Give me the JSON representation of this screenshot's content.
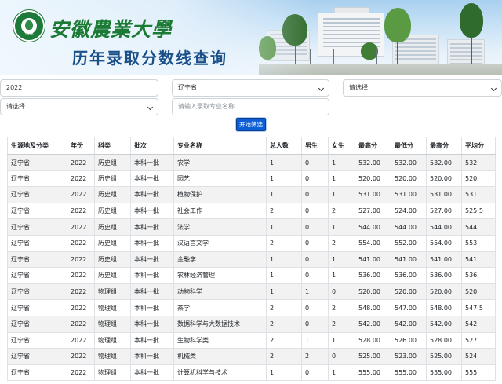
{
  "header": {
    "university_name": "安徽農業大學",
    "page_title": "历年录取分数线查询",
    "seal_year": "1928"
  },
  "filters": {
    "year": {
      "value": "2022"
    },
    "province": {
      "value": "辽宁省"
    },
    "select_3": {
      "value": "请选择"
    },
    "select_4": {
      "value": "请选择"
    },
    "major_input": {
      "placeholder": "请输入录取专业名称"
    },
    "search_button_label": "开始筛选"
  },
  "table": {
    "columns": [
      "生源地及分类",
      "年份",
      "科类",
      "批次",
      "专业名称",
      "总人数",
      "男生",
      "女生",
      "最高分",
      "最低分",
      "最高分",
      "平均分"
    ],
    "rows": [
      [
        "辽宁省",
        "2022",
        "历史组",
        "本科一批",
        "农学",
        "1",
        "0",
        "1",
        "532.00",
        "532.00",
        "532.00",
        "532"
      ],
      [
        "辽宁省",
        "2022",
        "历史组",
        "本科一批",
        "园艺",
        "1",
        "0",
        "1",
        "520.00",
        "520.00",
        "520.00",
        "520"
      ],
      [
        "辽宁省",
        "2022",
        "历史组",
        "本科一批",
        "植物保护",
        "1",
        "0",
        "1",
        "531.00",
        "531.00",
        "531.00",
        "531"
      ],
      [
        "辽宁省",
        "2022",
        "历史组",
        "本科一批",
        "社会工作",
        "2",
        "0",
        "2",
        "527.00",
        "524.00",
        "527.00",
        "525.5"
      ],
      [
        "辽宁省",
        "2022",
        "历史组",
        "本科一批",
        "法学",
        "1",
        "0",
        "1",
        "544.00",
        "544.00",
        "544.00",
        "544"
      ],
      [
        "辽宁省",
        "2022",
        "历史组",
        "本科一批",
        "汉语言文学",
        "2",
        "0",
        "2",
        "554.00",
        "552.00",
        "554.00",
        "553"
      ],
      [
        "辽宁省",
        "2022",
        "历史组",
        "本科一批",
        "金融学",
        "1",
        "0",
        "1",
        "541.00",
        "541.00",
        "541.00",
        "541"
      ],
      [
        "辽宁省",
        "2022",
        "历史组",
        "本科一批",
        "农林经济管理",
        "1",
        "0",
        "1",
        "536.00",
        "536.00",
        "536.00",
        "536"
      ],
      [
        "辽宁省",
        "2022",
        "物理组",
        "本科一批",
        "动物科学",
        "1",
        "1",
        "0",
        "520.00",
        "520.00",
        "520.00",
        "520"
      ],
      [
        "辽宁省",
        "2022",
        "物理组",
        "本科一批",
        "茶学",
        "2",
        "0",
        "2",
        "548.00",
        "547.00",
        "548.00",
        "547.5"
      ],
      [
        "辽宁省",
        "2022",
        "物理组",
        "本科一批",
        "数据科学与大数据技术",
        "2",
        "0",
        "2",
        "542.00",
        "542.00",
        "542.00",
        "542"
      ],
      [
        "辽宁省",
        "2022",
        "物理组",
        "本科一批",
        "生物科学类",
        "2",
        "1",
        "1",
        "528.00",
        "526.00",
        "528.00",
        "527"
      ],
      [
        "辽宁省",
        "2022",
        "物理组",
        "本科一批",
        "机械类",
        "2",
        "2",
        "0",
        "525.00",
        "523.00",
        "525.00",
        "524"
      ],
      [
        "辽宁省",
        "2022",
        "物理组",
        "本科一批",
        "计算机科学与技术",
        "1",
        "0",
        "1",
        "555.00",
        "555.00",
        "555.00",
        "555"
      ]
    ]
  },
  "colors": {
    "accent": "#0b5ed7",
    "brand_green": "#1b7a33",
    "title_blue": "#1a4f8a",
    "row_stripe": "#f2f2f2"
  },
  "icons": {
    "logo": "university-seal-icon",
    "dropdown": "chevron-down-icon"
  }
}
